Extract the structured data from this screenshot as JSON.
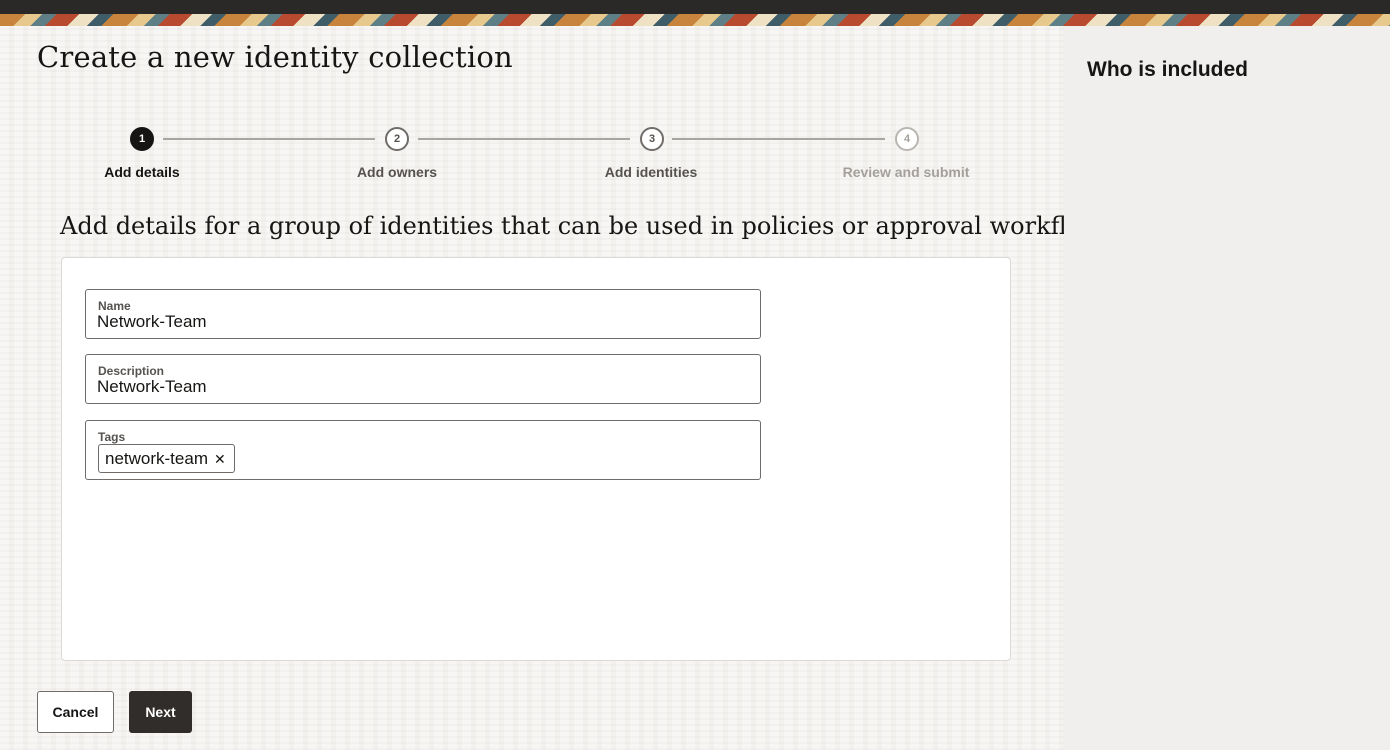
{
  "page": {
    "title": "Create a new identity collection",
    "subtitle": "Add details for a group of identities that can be used in policies or approval workflows."
  },
  "stepper": {
    "steps": [
      {
        "number": "1",
        "label": "Add details",
        "state": "active"
      },
      {
        "number": "2",
        "label": "Add owners",
        "state": "pending"
      },
      {
        "number": "3",
        "label": "Add identities",
        "state": "pending"
      },
      {
        "number": "4",
        "label": "Review and submit",
        "state": "inactive"
      }
    ]
  },
  "form": {
    "name": {
      "label": "Name",
      "value": "Network-Team"
    },
    "description": {
      "label": "Description",
      "value": "Network-Team"
    },
    "tags": {
      "label": "Tags",
      "chips": [
        {
          "text": "network-team",
          "remove_icon": "close-icon"
        }
      ]
    }
  },
  "actions": {
    "cancel_label": "Cancel",
    "next_label": "Next"
  },
  "sidebar": {
    "title": "Who is included"
  },
  "colors": {
    "primary_button": "#312d2a",
    "active_step": "#161513",
    "background": "#f3f1ee"
  }
}
